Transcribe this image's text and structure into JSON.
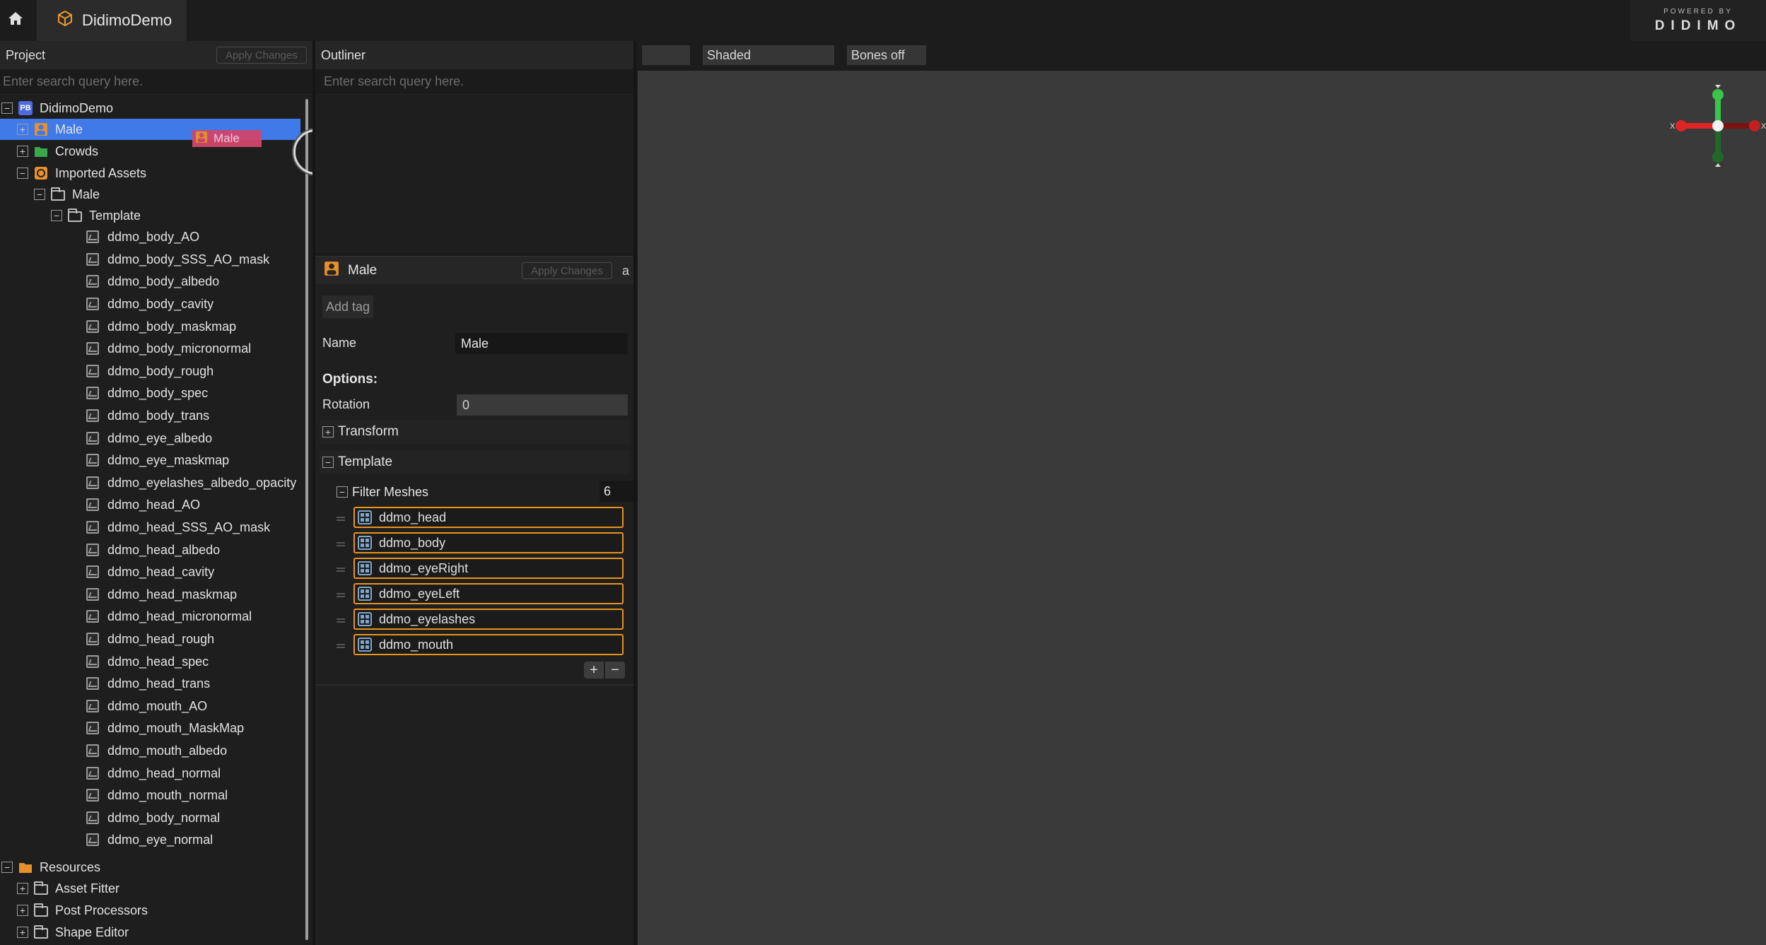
{
  "app": {
    "tab_title": "DidimoDemo",
    "brand_powered": "POWERED BY",
    "brand_name": "DIDIMO",
    "colors": {
      "selection": "#3f7ae8",
      "mesh_border": "#e8931c",
      "drag_ghost": "#d1466d"
    }
  },
  "project": {
    "title": "Project",
    "apply_label": "Apply Changes",
    "search_placeholder": "Enter search query here.",
    "root": "DidimoDemo",
    "root_badge": "PB",
    "items": {
      "male": "Male",
      "crowds": "Crowds",
      "imported_assets": "Imported Assets",
      "imported_male": "Male",
      "template": "Template",
      "resources": "Resources",
      "asset_fitter": "Asset Fitter",
      "post_processors": "Post Processors",
      "shape_editor": "Shape Editor"
    },
    "textures": [
      "ddmo_body_AO",
      "ddmo_body_SSS_AO_mask",
      "ddmo_body_albedo",
      "ddmo_body_cavity",
      "ddmo_body_maskmap",
      "ddmo_body_micronormal",
      "ddmo_body_rough",
      "ddmo_body_spec",
      "ddmo_body_trans",
      "ddmo_eye_albedo",
      "ddmo_eye_maskmap",
      "ddmo_eyelashes_albedo_opacity",
      "ddmo_head_AO",
      "ddmo_head_SSS_AO_mask",
      "ddmo_head_albedo",
      "ddmo_head_cavity",
      "ddmo_head_maskmap",
      "ddmo_head_micronormal",
      "ddmo_head_rough",
      "ddmo_head_spec",
      "ddmo_head_trans",
      "ddmo_mouth_AO",
      "ddmo_mouth_MaskMap",
      "ddmo_mouth_albedo",
      "ddmo_head_normal",
      "ddmo_mouth_normal",
      "ddmo_body_normal",
      "ddmo_eye_normal"
    ],
    "drag_ghost_label": "Male"
  },
  "outliner": {
    "title": "Outliner",
    "search_placeholder": "Enter search query here."
  },
  "inspector": {
    "title": "Male",
    "apply_label": "Apply Changes",
    "lock_glyph": "a",
    "add_tag": "Add tag",
    "name_label": "Name",
    "name_value": "Male",
    "options_label": "Options:",
    "rotation_label": "Rotation",
    "rotation_value": "0",
    "transform_label": "Transform",
    "template_label": "Template",
    "filter_meshes_label": "Filter Meshes",
    "filter_meshes_count": "6",
    "meshes": [
      "ddmo_head",
      "ddmo_body",
      "ddmo_eyeRight",
      "ddmo_eyeLeft",
      "ddmo_eyelashes",
      "ddmo_mouth"
    ],
    "plus": "+",
    "minus": "−"
  },
  "viewport": {
    "shading_label": "Shaded",
    "bones_label": "Bones off",
    "gizmo_axes": [
      "X",
      "X",
      "Y"
    ]
  }
}
